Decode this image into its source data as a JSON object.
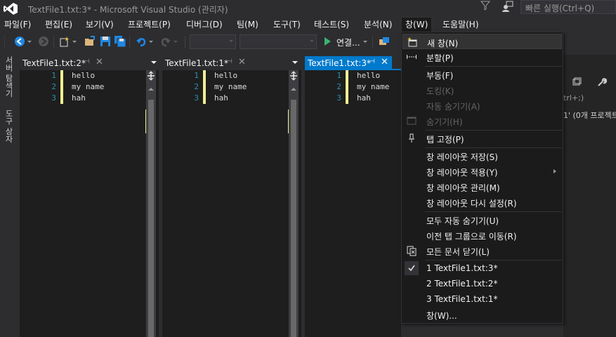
{
  "title": {
    "window_title": "TextFile1.txt:3* - Microsoft Visual Studio (관리자)",
    "quick_launch_placeholder": "빠른 실행(Ctrl+Q)"
  },
  "menubar": {
    "items": [
      "파일(F)",
      "편집(E)",
      "보기(V)",
      "프로젝트(P)",
      "디버그(D)",
      "팀(M)",
      "도구(T)",
      "테스트(S)",
      "분석(N)",
      "창(W)",
      "도움말(H)"
    ]
  },
  "toolbar": {
    "connect_label": "연결..."
  },
  "left_tabs": {
    "server_explorer": "서버 탐색기",
    "toolbox": "도구 상자"
  },
  "panes": [
    {
      "tab": "TextFile1.txt:2*",
      "active": false
    },
    {
      "tab": "TextFile1.txt:1*",
      "active": false
    },
    {
      "tab": "TextFile1.txt:3*",
      "active": true
    }
  ],
  "code": {
    "lines": [
      {
        "num": "1",
        "text": "hello"
      },
      {
        "num": "2",
        "text": "my name"
      },
      {
        "num": "3",
        "text": "hah"
      }
    ]
  },
  "right_panel": {
    "text1": "trl+;)",
    "text2": "1' (0개 프로젝트"
  },
  "window_menu": {
    "items": [
      {
        "label": "새 창(N)",
        "icon": "new-window-icon",
        "hover": true
      },
      {
        "label": "분할(P)",
        "icon": "split-icon"
      },
      {
        "label": "부동(F)"
      },
      {
        "label": "도킹(K)",
        "disabled": true
      },
      {
        "label": "자동 숨기기(A)",
        "disabled": true
      },
      {
        "label": "숨기기(H)",
        "disabled": true,
        "icon": "hide-icon"
      },
      {
        "label": "탭 고정(P)",
        "icon": "pin-icon"
      },
      {
        "label": "창 레이아웃 저장(S)"
      },
      {
        "label": "창 레이아웃 적용(Y)",
        "submenu": true
      },
      {
        "label": "창 레이아웃 관리(M)"
      },
      {
        "label": "창 레이아웃 다시 설정(R)"
      },
      {
        "label": "모두 자동 숨기기(U)"
      },
      {
        "label": "이전 탭 그룹으로 이동(R)"
      },
      {
        "label": "모든 문서 닫기(L)",
        "icon": "close-all-icon"
      },
      {
        "label": "1 TextFile1.txt:3*",
        "checked": true
      },
      {
        "label": "2 TextFile1.txt:2*"
      },
      {
        "label": "3 TextFile1.txt:1*"
      },
      {
        "label": "창(W)..."
      }
    ]
  },
  "colors": {
    "accent": "#007acc",
    "background": "#2d2d30",
    "editor": "#1e1e1e",
    "line_number": "#2b91af",
    "change_marker": "#efef91"
  }
}
